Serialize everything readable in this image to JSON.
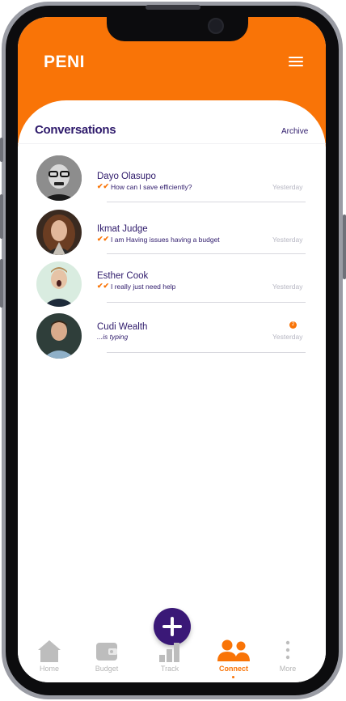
{
  "app": {
    "brand": "PENI"
  },
  "header": {
    "section_title": "Conversations",
    "archive_label": "Archive"
  },
  "conversations": [
    {
      "name": "Dayo Olasupo",
      "preview": "How can I save efficiently?",
      "time": "Yesterday",
      "read_check": "✔✔",
      "avatar": "man-glasses-avatar"
    },
    {
      "name": "Ikmat Judge",
      "preview": "I am Having issues having a budget",
      "time": "Yesterday",
      "read_check": "✔✔",
      "avatar": "woman-avatar"
    },
    {
      "name": "Esther Cook",
      "preview": "I really just need help",
      "time": "Yesterday",
      "read_check": "✔✔",
      "avatar": "man-surprised-avatar"
    },
    {
      "name": "Cudi Wealth",
      "preview": "...is typing",
      "time": "Yesterday",
      "unread": "2",
      "avatar": "man-smiling-avatar"
    }
  ],
  "nav": [
    {
      "label": "Home",
      "icon": "home-icon"
    },
    {
      "label": "Budget",
      "icon": "wallet-icon"
    },
    {
      "label": "Track",
      "icon": "bar-chart-icon"
    },
    {
      "label": "Connect",
      "icon": "people-icon",
      "active": true
    },
    {
      "label": "More",
      "icon": "more-vertical-icon"
    }
  ],
  "colors": {
    "accent": "#f97407",
    "brand_dark": "#2e1a6b",
    "fab": "#3a1877"
  }
}
